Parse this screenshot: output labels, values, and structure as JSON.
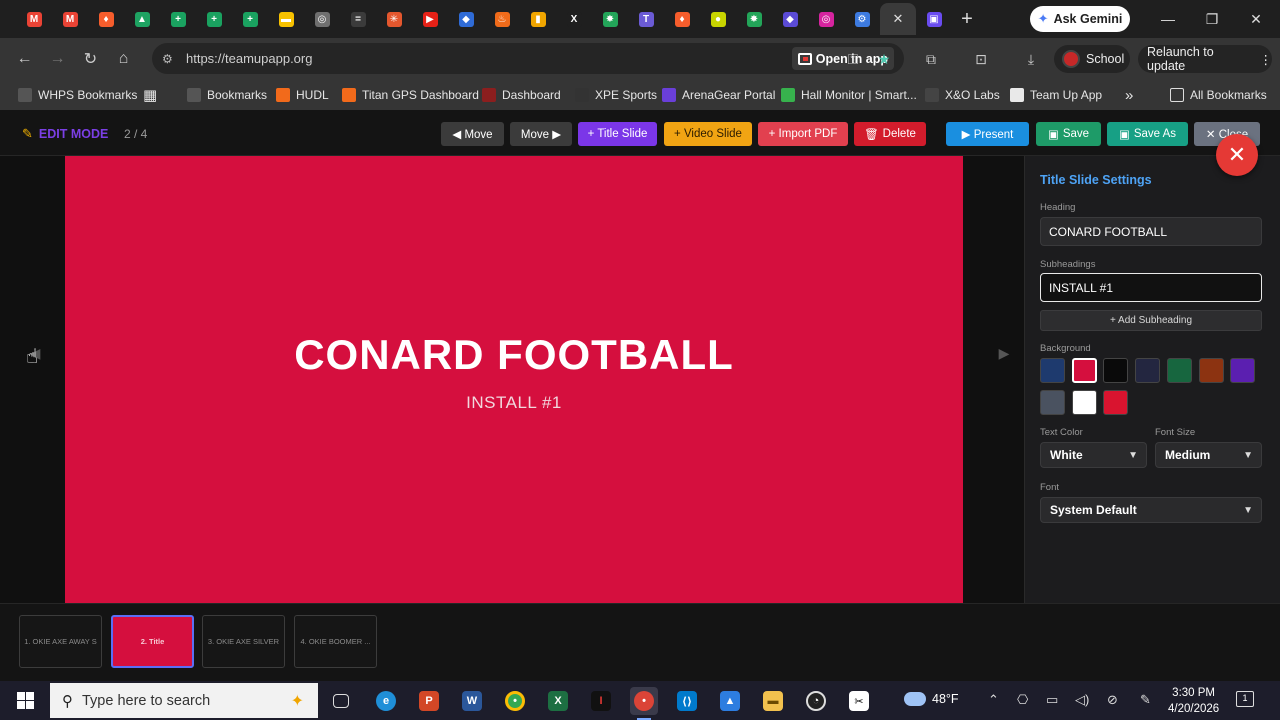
{
  "browser": {
    "url": "https://teamupapp.org",
    "open_in_app": "Open in app",
    "gemini": "Ask Gemini",
    "profile": "School",
    "relaunch": "Relaunch to update",
    "tab_favicons": [
      {
        "name": "gmail-tab",
        "color": "#ea4335",
        "glyph": "M"
      },
      {
        "name": "gmail-tab-2",
        "color": "#ea4335",
        "glyph": "M"
      },
      {
        "name": "brave-tab",
        "color": "#f65d2c",
        "glyph": "♦"
      },
      {
        "name": "drive-tab",
        "color": "#1ea362",
        "glyph": "▲"
      },
      {
        "name": "sheets-tab",
        "color": "#1aa260",
        "glyph": "+"
      },
      {
        "name": "sheets-tab-2",
        "color": "#1aa260",
        "glyph": "+"
      },
      {
        "name": "sheets-tab-3",
        "color": "#1aa260",
        "glyph": "+"
      },
      {
        "name": "keep-tab",
        "color": "#f7c100",
        "glyph": "▬"
      },
      {
        "name": "globe-tab",
        "color": "#6f6f6f",
        "glyph": "◎"
      },
      {
        "name": "dash-tab",
        "color": "#3b3b3b",
        "glyph": "="
      },
      {
        "name": "star-tab",
        "color": "#e4572e",
        "glyph": "✳"
      },
      {
        "name": "youtube-tab",
        "color": "#e62117",
        "glyph": "▶"
      },
      {
        "name": "shield-tab",
        "color": "#2f6bd6",
        "glyph": "◆"
      },
      {
        "name": "fire-tab",
        "color": "#f06b1a",
        "glyph": "♨"
      },
      {
        "name": "chart-tab",
        "color": "#f0a500",
        "glyph": "▮"
      },
      {
        "name": "x-tab",
        "color": "#1f1f1f",
        "glyph": "X"
      },
      {
        "name": "spark-tab",
        "color": "#23a559",
        "glyph": "✸"
      },
      {
        "name": "translate-tab",
        "color": "#6b5bd5",
        "glyph": "T"
      },
      {
        "name": "brave-tab-2",
        "color": "#f65d2c",
        "glyph": "♦"
      },
      {
        "name": "ball-tab",
        "color": "#c8d400",
        "glyph": "●"
      },
      {
        "name": "spark-tab-2",
        "color": "#23a559",
        "glyph": "✸"
      },
      {
        "name": "shield-tab-2",
        "color": "#5b4bd6",
        "glyph": "◆"
      },
      {
        "name": "instagram-tab",
        "color": "#d6249f",
        "glyph": "◎"
      },
      {
        "name": "settings-tab",
        "color": "#3d7be0",
        "glyph": "⚙"
      },
      {
        "name": "active-tab",
        "color": "#3a3a3a",
        "glyph": "✕"
      },
      {
        "name": "teamup-tab",
        "color": "#6a4cf0",
        "glyph": "▣"
      }
    ]
  },
  "bookmarks": [
    {
      "label": "WHPS Bookmarks",
      "icon": "folder-icon",
      "color": "#555"
    },
    {
      "label": "Bookmarks",
      "icon": "star-icon",
      "color": "#555"
    },
    {
      "label": "HUDL",
      "icon": "hudl-icon",
      "color": "#f26a1b"
    },
    {
      "label": "Titan GPS Dashboard",
      "icon": "titan-icon",
      "color": "#f26a1b"
    },
    {
      "label": "Dashboard",
      "icon": "dashboard-icon",
      "color": "#8b1e1e"
    },
    {
      "label": "XPE Sports",
      "icon": "xpe-icon",
      "color": "#333"
    },
    {
      "label": "ArenaGear Portal",
      "icon": "arenagear-icon",
      "color": "#6a3fd9"
    },
    {
      "label": "Hall Monitor | Smart...",
      "icon": "hall-monitor-icon",
      "color": "#37b24d"
    },
    {
      "label": "X&O Labs",
      "icon": "xo-icon",
      "color": "#444"
    },
    {
      "label": "Team Up App",
      "icon": "teamup-icon",
      "color": "#e9e9e9"
    }
  ],
  "all_bookmarks": "All Bookmarks",
  "editor": {
    "mode": "EDIT MODE",
    "count": "2 / 4",
    "buttons": {
      "move_left": "◀ Move",
      "move_right": "Move ▶",
      "title_slide": "+ Title Slide",
      "video_slide": "+ Video Slide",
      "import_pdf": "+ Import PDF",
      "delete": "Delete",
      "present": "▶ Present",
      "save": "Save",
      "save_as": "Save As",
      "close": "✕ Close"
    }
  },
  "slide": {
    "heading": "CONARD FOOTBALL",
    "subheading": "INSTALL #1",
    "background": "#d50f3e"
  },
  "settings": {
    "title": "Title Slide Settings",
    "heading_label": "Heading",
    "heading_value": "CONARD FOOTBALL",
    "subheadings_label": "Subheadings",
    "subheading_value": "INSTALL #1",
    "add_subheading": "+ Add Subheading",
    "background_label": "Background",
    "swatches": [
      "#1e3a6e",
      "#d50f3e",
      "#0a0a0a",
      "#232640",
      "#17663f",
      "#8c3311",
      "#5b1fb0",
      "#4a5260",
      "#ffffff",
      "#d9142f"
    ],
    "selected_swatch": 1,
    "text_color_label": "Text Color",
    "text_color_value": "White",
    "font_size_label": "Font Size",
    "font_size_value": "Medium",
    "font_label": "Font",
    "font_value": "System Default"
  },
  "thumbnails": [
    {
      "label": "1. OKIE AXE AWAY S",
      "active": false
    },
    {
      "label": "2. Title",
      "active": true
    },
    {
      "label": "3. OKIE AXE SILVER",
      "active": false
    },
    {
      "label": "4. OKIE BOOMER ...",
      "active": false
    }
  ],
  "taskbar": {
    "search_placeholder": "Type here to search",
    "weather": "48°F",
    "time": "3:30 PM",
    "date": "4/20/2026",
    "notifications": "1"
  }
}
